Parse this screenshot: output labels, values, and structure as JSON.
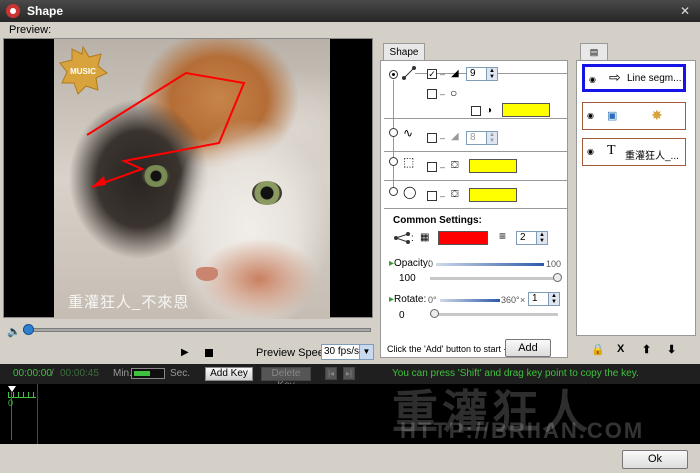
{
  "window": {
    "title": "Shape"
  },
  "preview": {
    "label": "Preview:",
    "badge_text": "MUSIC",
    "watermark": "重灌狂人_不來恩"
  },
  "player": {
    "speed_label": "Preview Speed:",
    "speed_value": "30 fps/s"
  },
  "shape_panel": {
    "tab_label": "Shape",
    "line": {
      "width_value": "9",
      "color": "#ffff00"
    },
    "curve": {
      "width_value": "8"
    },
    "rect": {
      "fill_color": "#ffff00"
    },
    "ellipse": {
      "fill_color": "#ffff00"
    },
    "common_title": "Common Settings:",
    "line_color": "#ff0000",
    "line_weight": "2",
    "opacity": {
      "label": "Opacity",
      "min": "0",
      "max": "100",
      "value": "100",
      "value_fraction": 1.0
    },
    "rotate": {
      "label": "Rotate",
      "min": "0°",
      "max": "360°",
      "multiplier_sign": "×",
      "multiplier": "1",
      "value": "0",
      "value_fraction": 0.0
    },
    "hint": "Click the 'Add' button to start ->",
    "add_label": "Add"
  },
  "layers": {
    "items": [
      {
        "label": "Line segm...",
        "icon": "arrow-outline-icon",
        "active": true
      },
      {
        "label": "",
        "icon": "image-sticker-icon",
        "active": false
      },
      {
        "label": "重灌狂人_...",
        "icon": "text-icon",
        "active": false
      }
    ],
    "controls": {
      "lock": "🔒",
      "delete": "X",
      "up": "⬆",
      "down": "⬇"
    }
  },
  "timeline": {
    "current": "00:00:00",
    "separator": "/",
    "total": "00:00:45",
    "min_label": "Min.",
    "sec_label": "Sec.",
    "add_key": "Add Key",
    "delete_key": "Delete Key",
    "hint": "You can press 'Shift' and drag key point to copy the key.",
    "zero": "0",
    "watermark": "重灌狂人",
    "url": "HTTP://BRIIAN.COM"
  },
  "footer": {
    "ok_label": "Ok"
  },
  "colors": {
    "accent": "#1414e6",
    "timeline_green": "#3ec13e",
    "line": "#ff0000"
  }
}
